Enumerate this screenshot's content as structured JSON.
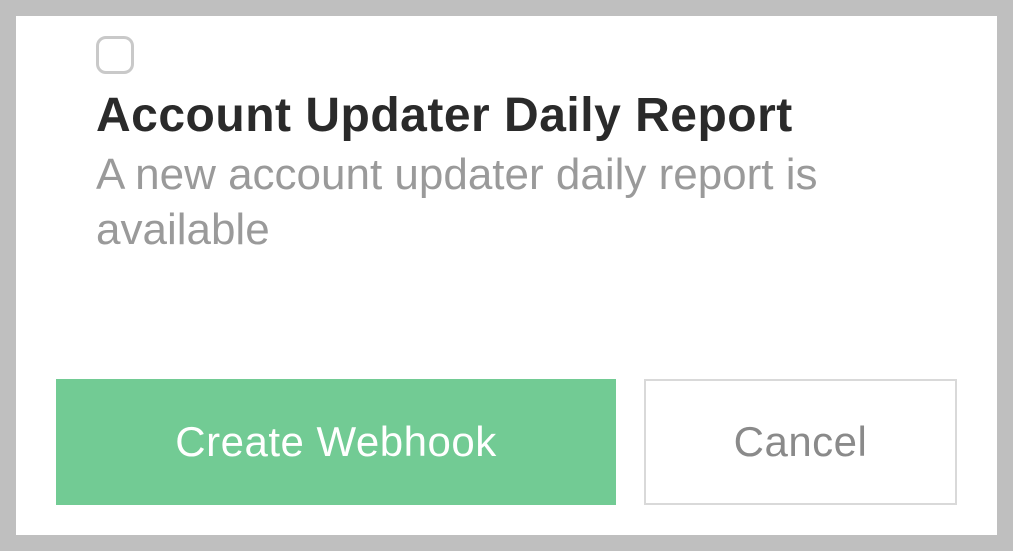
{
  "option": {
    "title": "Account Updater Daily Report",
    "description": "A new account updater daily report is available"
  },
  "actions": {
    "primary_label": "Create Webhook",
    "secondary_label": "Cancel"
  }
}
